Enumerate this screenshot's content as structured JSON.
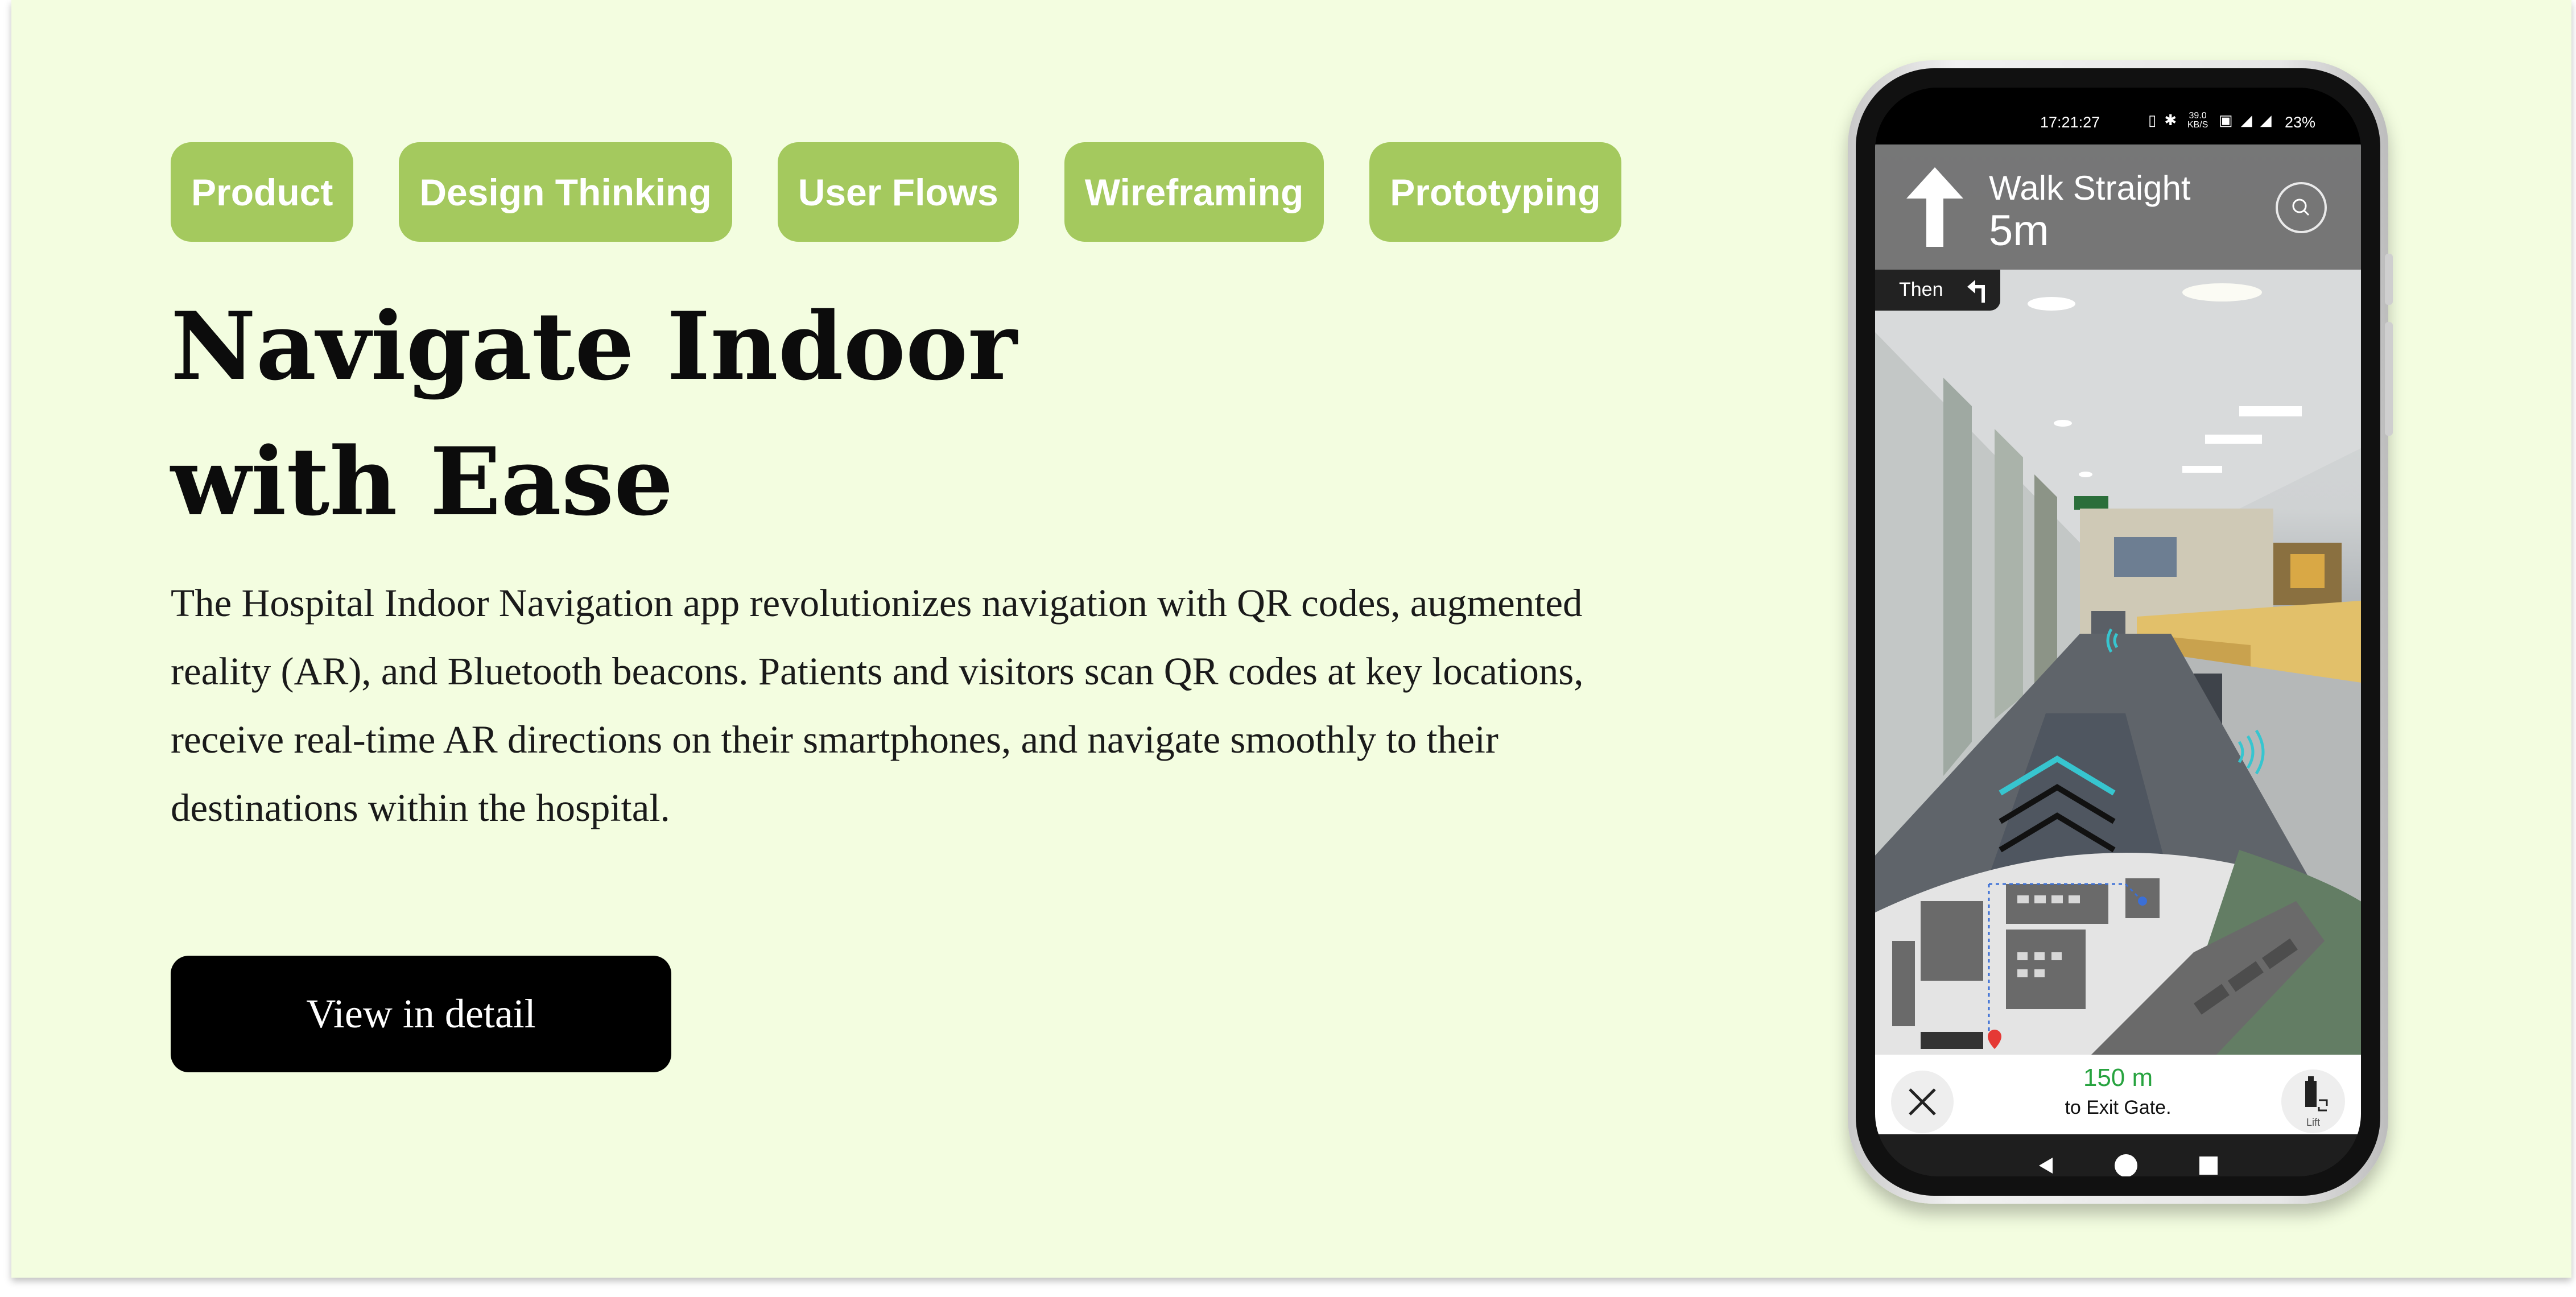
{
  "tags": [
    "Product",
    "Design Thinking",
    "User Flows",
    "Wireframing",
    "Prototyping"
  ],
  "title_line1": "Navigate Indoor",
  "title_line2": "with Ease",
  "description": "The Hospital Indoor Navigation app revolutionizes navigation with QR codes, augmented reality (AR), and Bluetooth beacons. Patients and visitors scan QR codes at key locations, receive real-time AR directions on their smartphones, and navigate smoothly to their destinations within the hospital.",
  "cta_label": "View in detail",
  "colors": {
    "background": "#f3fde0",
    "tag": "#a4c95e",
    "cta": "#000000",
    "distance": "#27a33f",
    "ar_arrow": "#37c5cf"
  },
  "phone": {
    "status_time": "17:21:27",
    "status_net_speed": "39.0 KB/S",
    "status_battery": "23%",
    "instruction": "Walk Straight",
    "instruction_distance": "5m",
    "then_label": "Then",
    "remaining_distance": "150 m",
    "destination": "to Exit Gate.",
    "lift_label": "Lift",
    "icons": [
      "up-arrow-icon",
      "search-icon",
      "turn-left-icon",
      "close-icon",
      "lift-icon",
      "back-icon",
      "home-icon",
      "recents-icon"
    ]
  }
}
